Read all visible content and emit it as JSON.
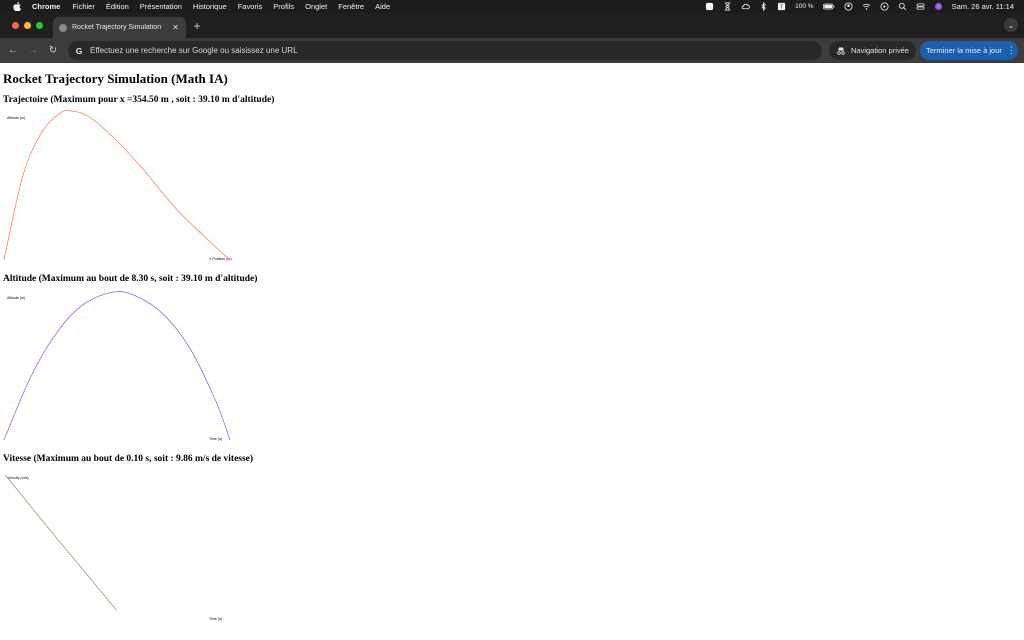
{
  "menubar": {
    "app_name": "Chrome",
    "items": [
      "Fichier",
      "Édition",
      "Présentation",
      "Historique",
      "Favoris",
      "Profils",
      "Onglet",
      "Fenêtre",
      "Aide"
    ],
    "battery": "100 %",
    "clock": "Sam. 26 avr.  11:14"
  },
  "browser": {
    "tab_title": "Rocket Trajectory Simulation",
    "omnibox_placeholder": "Effectuez une recherche sur Google ou saisissez une URL",
    "incognito_label": "Navigation privée",
    "update_label": "Terminer la mise à jour"
  },
  "page": {
    "title": "Rocket Trajectory Simulation (Math IA)"
  },
  "colors": {
    "trajectory": "#ff7f66",
    "altitude": "#6f7ff5",
    "velocity": "#8aa66a"
  },
  "chart_data": [
    {
      "type": "line",
      "title": "Trajectoire (Maximum pour x =354.50 m , soit : 39.10 m d'altitude)",
      "ylabel": "Altitude (m)",
      "xlabel": "X Position (m)",
      "peak": {
        "x": 354.5,
        "y": 39.1
      },
      "x_end": 1190,
      "series": [
        {
          "points": [
            [
              0,
              0
            ],
            [
              100,
              22.2
            ],
            [
              200,
              33.6
            ],
            [
              300,
              38.7
            ],
            [
              354.5,
              39.1
            ],
            [
              450,
              37.5
            ],
            [
              600,
              31.0
            ],
            [
              750,
              22.8
            ],
            [
              900,
              13.8
            ],
            [
              1050,
              6.4
            ],
            [
              1190,
              0
            ]
          ]
        }
      ]
    },
    {
      "type": "line",
      "title": "Altitude (Maximum au bout de 8.30 s, soit : 39.10 m d'altitude)",
      "ylabel": "Altitude (m)",
      "xlabel": "Time (s)",
      "peak": {
        "x": 8.3,
        "y": 39.1
      },
      "x_end": 17.1,
      "series": [
        {
          "points": [
            [
              0,
              0
            ],
            [
              2,
              16.5
            ],
            [
              4,
              28.4
            ],
            [
              6,
              35.8
            ],
            [
              8.3,
              39.1
            ],
            [
              10,
              38.0
            ],
            [
              12,
              33.4
            ],
            [
              14,
              24.6
            ],
            [
              16,
              10.5
            ],
            [
              17.1,
              0
            ]
          ]
        }
      ]
    },
    {
      "type": "line",
      "title": "Vitesse (Maximum au bout de 0.10 s, soit : 9.86 m/s de vitesse)",
      "ylabel": "Velocity (m/s)",
      "xlabel": "Time (s)",
      "peak": {
        "x": 0.1,
        "y": 9.86
      },
      "x_end": 17.1,
      "series": [
        {
          "points": [
            [
              0.1,
              9.86
            ],
            [
              2,
              7.75
            ],
            [
              4,
              5.55
            ],
            [
              6,
              3.4
            ],
            [
              8.3,
              0.9
            ],
            [
              8.4,
              0.79
            ]
          ]
        }
      ]
    }
  ]
}
